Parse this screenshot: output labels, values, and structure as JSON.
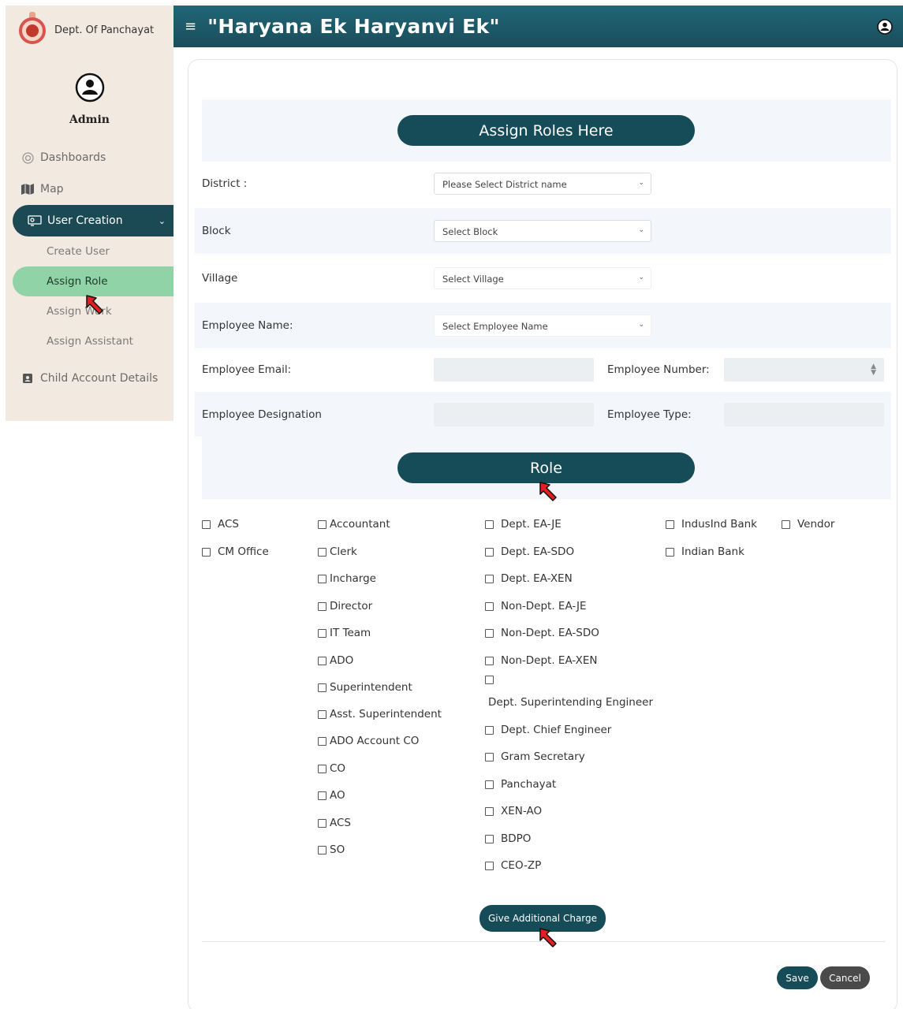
{
  "sidebar": {
    "brand": "Dept. Of Panchayat",
    "user_name": "Admin",
    "items": [
      {
        "label": "Dashboards",
        "icon": "dashboard-icon"
      },
      {
        "label": "Map",
        "icon": "map-icon"
      },
      {
        "label": "User Creation",
        "icon": "user-creation-icon"
      },
      {
        "label": "Child Account Details",
        "icon": "id-card-icon"
      }
    ],
    "sub_items": [
      "Create User",
      "Assign Role",
      "Assign Work",
      "Assign Assistant"
    ]
  },
  "header": {
    "title": "\"Haryana Ek Haryanvi Ek\""
  },
  "form": {
    "heading": "Assign Roles Here",
    "district_label": "District :",
    "district_placeholder": "Please Select District name",
    "block_label": "Block",
    "block_placeholder": "Select Block",
    "village_label": "Village",
    "village_placeholder": "Select Village",
    "employee_name_label": "Employee Name:",
    "employee_name_placeholder": "Select Employee Name",
    "employee_email_label": "Employee Email:",
    "employee_number_label": "Employee Number:",
    "employee_designation_label": "Employee Designation",
    "employee_type_label": "Employee Type:"
  },
  "roles": {
    "heading": "Role",
    "col1": [
      "ACS",
      "CM Office"
    ],
    "col2": [
      "Accountant",
      "Clerk",
      "Incharge",
      "Director",
      "IT Team",
      "ADO",
      "Superintendent",
      "Asst. Superintendent",
      "ADO Account CO",
      "CO",
      "AO",
      "ACS",
      "SO"
    ],
    "col3": [
      "Dept. EA-JE",
      "Dept. EA-SDO",
      "Dept. EA-XEN",
      "Non-Dept. EA-JE",
      "Non-Dept. EA-SDO",
      "Non-Dept. EA-XEN",
      "Dept. Superintending Engineer",
      "Dept. Chief Engineer",
      "Gram Secretary",
      "Panchayat",
      "XEN-AO",
      "BDPO",
      "CEO-ZP"
    ],
    "col4": [
      "IndusInd Bank",
      "Indian Bank"
    ],
    "col5": [
      "Vendor"
    ]
  },
  "actions": {
    "additional_charge": "Give Additional Charge",
    "save": "Save",
    "cancel": "Cancel"
  },
  "colors": {
    "primary": "#164b58",
    "active_sub": "#8fd3a6",
    "sidebar_bg": "#f2e9e0"
  }
}
